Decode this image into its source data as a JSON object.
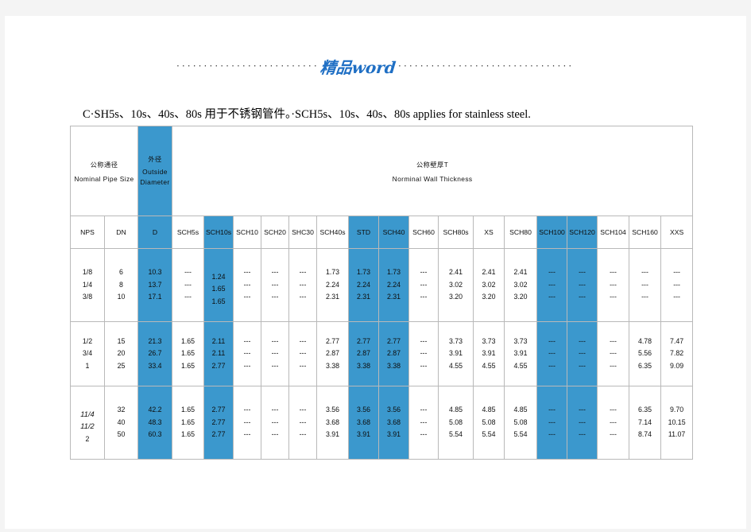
{
  "header": {
    "watermark_text": "精品word",
    "dots_left": "·····························",
    "dots_right": "································"
  },
  "caption": "C·SH5s、10s、40s、80s 用于不锈钢管件。·SCH5s、10s、40s、80s  applies  for  stainless  steel.",
  "colors": {
    "accent_blue": "#3b98cd",
    "watermark_blue": "#1f6fc4",
    "border": "#b9b9b9",
    "page": "#ffffff",
    "canvas": "#f4f4f4"
  },
  "table": {
    "group_headers": [
      {
        "zh": "公称通径",
        "en": "Nominal  Pipe  Size",
        "highlight": false
      },
      {
        "zh": "外径",
        "en": "Outside Diameter",
        "highlight": true
      },
      {
        "zh": "公称壁厚T",
        "en": "Norminal  Wall  Thickness",
        "highlight": false
      }
    ],
    "columns": [
      {
        "label": "NPS",
        "highlight": false
      },
      {
        "label": "DN",
        "highlight": false
      },
      {
        "label": "D",
        "highlight": true
      },
      {
        "label": "SCH5s",
        "highlight": false
      },
      {
        "label": "SCH10s",
        "highlight": true
      },
      {
        "label": "SCH10",
        "highlight": false
      },
      {
        "label": "SCH20",
        "highlight": false
      },
      {
        "label": "SHC30",
        "highlight": false
      },
      {
        "label": "SCH40s",
        "highlight": false
      },
      {
        "label": "STD",
        "highlight": true
      },
      {
        "label": "SCH40",
        "highlight": true
      },
      {
        "label": "SCH60",
        "highlight": false
      },
      {
        "label": "SCH80s",
        "highlight": false
      },
      {
        "label": "XS",
        "highlight": false
      },
      {
        "label": "SCH80",
        "highlight": false
      },
      {
        "label": "SCH100",
        "highlight": true
      },
      {
        "label": "SCH120",
        "highlight": true
      },
      {
        "label": "SCH104",
        "highlight": false
      },
      {
        "label": "SCH160",
        "highlight": false
      },
      {
        "label": "XXS",
        "highlight": false
      }
    ],
    "row_groups": [
      {
        "NPS": [
          "1/8",
          "1/4",
          "3/8"
        ],
        "DN": [
          "6",
          "8",
          "10"
        ],
        "D": [
          "10.3",
          "13.7",
          "17.1"
        ],
        "SCH5s": [
          "---",
          "---",
          "---"
        ],
        "SCH10s": [
          "1.24",
          "1.65",
          "1.65"
        ],
        "SCH10": [
          "---",
          "---",
          "---"
        ],
        "SCH20": [
          "---",
          "---",
          "---"
        ],
        "SHC30": [
          "---",
          "---",
          "---"
        ],
        "SCH40s": [
          "1.73",
          "2.24",
          "2.31"
        ],
        "STD": [
          "1.73",
          "2.24",
          "2.31"
        ],
        "SCH40": [
          "1.73",
          "2.24",
          "2.31"
        ],
        "SCH60": [
          "---",
          "---",
          "---"
        ],
        "SCH80s": [
          "2.41",
          "3.02",
          "3.20"
        ],
        "XS": [
          "2.41",
          "3.02",
          "3.20"
        ],
        "SCH80": [
          "2.41",
          "3.02",
          "3.20"
        ],
        "SCH100": [
          "---",
          "---",
          "---"
        ],
        "SCH120": [
          "---",
          "---",
          "---"
        ],
        "SCH104": [
          "---",
          "---",
          "---"
        ],
        "SCH160": [
          "---",
          "---",
          "---"
        ],
        "XXS": [
          "---",
          "---",
          "---"
        ]
      },
      {
        "NPS": [
          "1/2",
          "3/4",
          "1"
        ],
        "DN": [
          "15",
          "20",
          "25"
        ],
        "D": [
          "21.3",
          "26.7",
          "33.4"
        ],
        "SCH5s": [
          "1.65",
          "1.65",
          "1.65"
        ],
        "SCH10s": [
          "2.11",
          "2.11",
          "2.77"
        ],
        "SCH10": [
          "---",
          "---",
          "---"
        ],
        "SCH20": [
          "---",
          "---",
          "---"
        ],
        "SHC30": [
          "---",
          "---",
          "---"
        ],
        "SCH40s": [
          "2.77",
          "2.87",
          "3.38"
        ],
        "STD": [
          "2.77",
          "2.87",
          "3.38"
        ],
        "SCH40": [
          "2.77",
          "2.87",
          "3.38"
        ],
        "SCH60": [
          "---",
          "---",
          "---"
        ],
        "SCH80s": [
          "3.73",
          "3.91",
          "4.55"
        ],
        "XS": [
          "3.73",
          "3.91",
          "4.55"
        ],
        "SCH80": [
          "3.73",
          "3.91",
          "4.55"
        ],
        "SCH100": [
          "---",
          "---",
          "---"
        ],
        "SCH120": [
          "---",
          "---",
          "---"
        ],
        "SCH104": [
          "---",
          "---",
          "---"
        ],
        "SCH160": [
          "4.78",
          "5.56",
          "6.35"
        ],
        "XXS": [
          "7.47",
          "7.82",
          "9.09"
        ]
      },
      {
        "NPS": [
          "11/4",
          "11/2",
          "2"
        ],
        "DN": [
          "32",
          "40",
          "50"
        ],
        "D": [
          "42.2",
          "48.3",
          "60.3"
        ],
        "SCH5s": [
          "1.65",
          "1.65",
          "1.65"
        ],
        "SCH10s": [
          "2.77",
          "2.77",
          "2.77"
        ],
        "SCH10": [
          "---",
          "---",
          "---"
        ],
        "SCH20": [
          "---",
          "---",
          "---"
        ],
        "SHC30": [
          "---",
          "---",
          "---"
        ],
        "SCH40s": [
          "3.56",
          "3.68",
          "3.91"
        ],
        "STD": [
          "3.56",
          "3.68",
          "3.91"
        ],
        "SCH40": [
          "3.56",
          "3.68",
          "3.91"
        ],
        "SCH60": [
          "---",
          "---",
          "---"
        ],
        "SCH80s": [
          "4.85",
          "5.08",
          "5.54"
        ],
        "XS": [
          "4.85",
          "5.08",
          "5.54"
        ],
        "SCH80": [
          "4.85",
          "5.08",
          "5.54"
        ],
        "SCH100": [
          "---",
          "---",
          "---"
        ],
        "SCH120": [
          "---",
          "---",
          "---"
        ],
        "SCH104": [
          "---",
          "---",
          "---"
        ],
        "SCH160": [
          "6.35",
          "7.14",
          "8.74"
        ],
        "XXS": [
          "9.70",
          "10.15",
          "11.07"
        ]
      }
    ]
  }
}
